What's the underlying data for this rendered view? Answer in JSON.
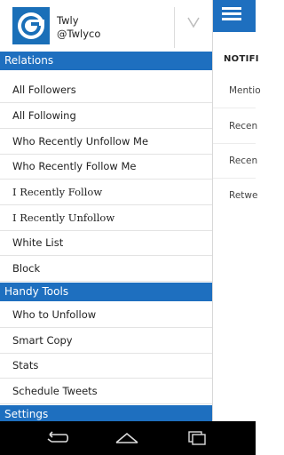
{
  "main": {
    "section_title": "NOTIFI",
    "items": [
      "Mentio",
      "Recen",
      "Recen",
      "Retwe"
    ]
  },
  "profile": {
    "name": "Twly",
    "handle": "@Twlyco"
  },
  "sections": {
    "relations": {
      "title": "Relations",
      "items": [
        "All Followers",
        "All Following",
        "Who Recently Unfollow Me",
        "Who Recently Follow Me",
        "I Recently Follow",
        "I Recently Unfollow",
        "White List",
        "Block"
      ]
    },
    "handy_tools": {
      "title": "Handy Tools",
      "items": [
        "Who to Unfollow",
        "Smart Copy",
        "Stats",
        "Schedule Tweets"
      ]
    },
    "settings": {
      "title": "Settings"
    }
  },
  "colors": {
    "accent": "#1e6fbf",
    "navbar": "#000000"
  },
  "icons": {
    "menu": "hamburger-icon",
    "expand": "chevron-down-icon",
    "back": "back-icon",
    "home": "home-icon",
    "recents": "recents-icon"
  }
}
